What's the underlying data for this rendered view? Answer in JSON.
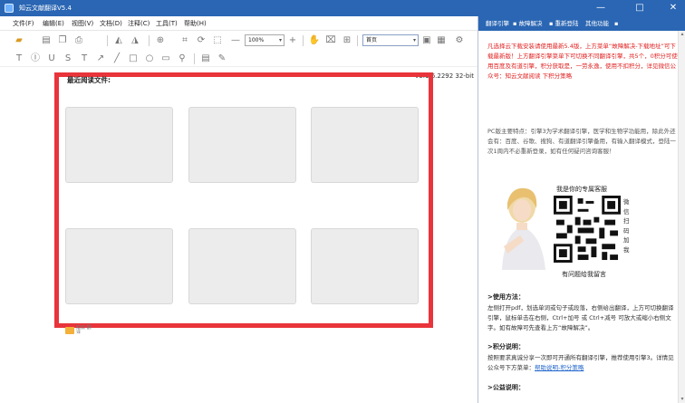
{
  "window": {
    "title": "知云文献翻译V5.4",
    "controls": {
      "minimize": "—",
      "maximize": "□",
      "close": "✕"
    }
  },
  "menu": {
    "items": [
      {
        "label": "文件(F)"
      },
      {
        "label": "编辑(E)"
      },
      {
        "label": "视图(V)"
      },
      {
        "label": "文档(D)"
      },
      {
        "label": "注释(C)"
      },
      {
        "label": "工具(T)"
      },
      {
        "label": "帮助(H)"
      }
    ]
  },
  "toolbar": {
    "zoom_value": "100%",
    "page_value": "首页",
    "icons_row1": [
      "open-folder-icon",
      "save-icon",
      "copy-icon",
      "print-icon",
      "zoom-in-icon",
      "zoom-out-icon",
      "crop-icon",
      "rotate-icon",
      "plus-icon",
      "hand-icon",
      "snapshot-icon",
      "select-icon",
      "page-icon",
      "settings-icon"
    ],
    "icons_row2": [
      "text-icon",
      "highlight-icon",
      "underline-icon",
      "strike-icon",
      "typewriter-icon",
      "arrow-icon",
      "line-icon",
      "rect-icon",
      "circle-icon",
      "image-icon",
      "stamp-icon",
      "comment-icon",
      "signature-icon"
    ]
  },
  "version": "V3.1.6.2292 32-bit",
  "recent": {
    "label": "最近阅读文件:",
    "card_count_label": ""
  },
  "bottom_logo_text": "知云 翻译",
  "right_panel": {
    "bar_items": [
      {
        "label": "翻译引擎"
      },
      {
        "label": "▪ 故障解决"
      },
      {
        "label": "▪ 重新登陆"
      },
      {
        "label": "其他功能"
      },
      {
        "label": "▪"
      }
    ],
    "notice": "凡选择云下载安装请使用最新5.4版，上方菜单“故障解决-下载地址”可下载最新版！上方翻译引擎菜单下可切换不同翻译引擎，共5个，0积分可使用百度及有道引擎，积分获取是，一劳永逸，使用不扣积分，详见微信公众号：知云文献阅读 下积分策略",
    "description": "PC版主要特点：引擎3为学术翻译引擎，医学和生物学功能用，除此外还会有：百度、谷歌、搜狗、有道翻译引擎备用，有输入翻译模式，登陆一次1周内不必重新登录，如有任何疑问咨询客服！",
    "promo_head": "我是你的专属客服",
    "scan_text": "微信扫码加我",
    "promo_foot": "有问题给我留言",
    "usage_title": ">使用方法：",
    "usage_body": "左侧打开pdf，划选单词或句子或段落，右侧给出翻译，上方可切换翻译引擎，鼠标单击在右侧，Ctrl+加号 或 Ctrl+减号 可放大或缩小右侧文字。如有故障可先查看上方“故障解决”。",
    "points_title": ">积分说明：",
    "points_body_prefix": "按照要求真诚分享一次即可开通所有翻译引擎，推荐使用引擎3。详情见公众号下方菜单：",
    "points_link": "帮助说明-积分策略",
    "public_title": ">公益说明："
  },
  "colors": {
    "titlebar": "#2a66b3",
    "highlight": "#e8343a",
    "notice_red": "#e02020",
    "card_bg": "#ececec"
  }
}
